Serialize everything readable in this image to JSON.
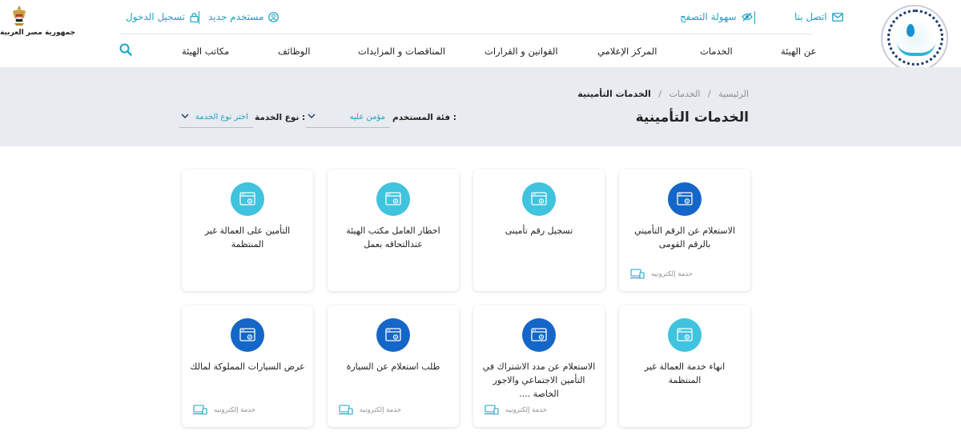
{
  "header": {
    "country": "جمهورية مصر العربية",
    "top_links": {
      "contact": "اتصل بنا",
      "accessibility": "سهولة التصفح",
      "new_user": "مستخدم جديد",
      "login": "تسجيل الدخول"
    },
    "nav": [
      "عن الهيئة",
      "الخدمات",
      "المركز الإعلامي",
      "القوانين و القرارات",
      "المناقصات و المزايدات",
      "الوظائف",
      "مكاتب الهيئة"
    ]
  },
  "breadcrumb": {
    "home": "الرئيسية",
    "sep": "/",
    "services": "الخدمات",
    "current": "الخدمات التأمينية"
  },
  "page_title": "الخدمات التأمينية",
  "filters": {
    "user_category_label": "فئة المستخدم :",
    "user_category_value": "مؤمن عليه",
    "service_type_label": "نوع الخدمة :",
    "service_type_value": "اختر نوع الخدمة"
  },
  "colors": {
    "accent": "#1aa4c7",
    "icon_light": "#3fc3de",
    "icon_dark": "#1466c8"
  },
  "cards": [
    {
      "title": "الاستعلام عن الرقم التأميني بالرقم القومى",
      "badge": "خدمة إلكترونيه",
      "icon": "dark"
    },
    {
      "title": "تسجيل رقم تأمينى",
      "badge": "",
      "icon": "light"
    },
    {
      "title": "اخطار العامل مكتب الهيئة عندالتحاقه بعمل",
      "badge": "",
      "icon": "light"
    },
    {
      "title": "التأمين على العمالة غير المنتظمة",
      "badge": "",
      "icon": "light"
    },
    {
      "title": "انهاء خدمة العمالة غير المنتظمة",
      "badge": "",
      "icon": "light"
    },
    {
      "title": "الاستعلام عن مدد الاشتراك في التأمين الاجتماعي والاجور الخاصة ....",
      "badge": "خدمة إلكترونيه",
      "icon": "dark"
    },
    {
      "title": "طلب استعلام عن السيارة",
      "badge": "خدمة إلكترونيه",
      "icon": "dark"
    },
    {
      "title": "عرض السيارات المملوكة لمالك",
      "badge": "خدمة إلكترونيه",
      "icon": "dark"
    }
  ]
}
